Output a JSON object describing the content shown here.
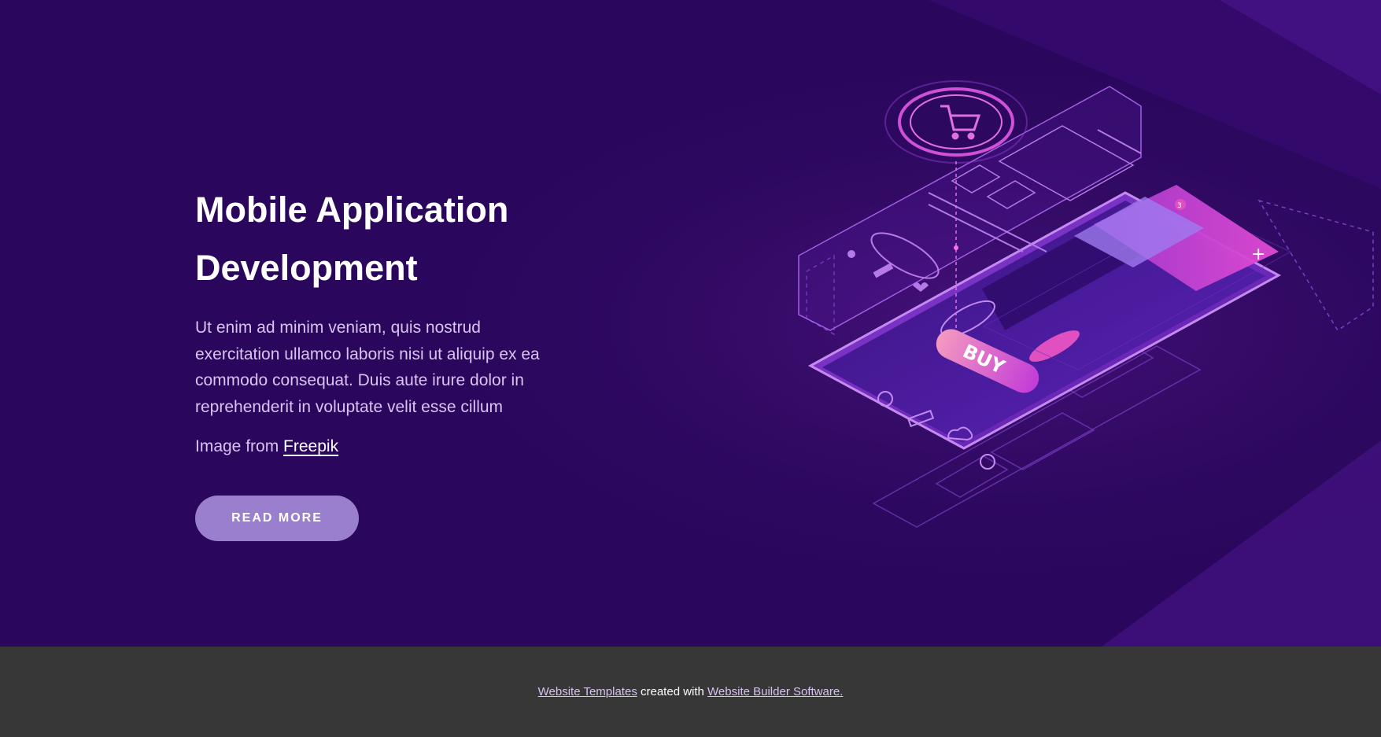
{
  "hero": {
    "title_line1": "Mobile Application",
    "title_line2": "Development",
    "text": "Ut enim ad minim veniam, quis nostrud exercitation ullamco laboris nisi ut aliquip ex ea commodo consequat. Duis aute irure dolor in reprehenderit in voluptate velit esse cillum",
    "credit_prefix": "Image from",
    "credit_link": "Freepik",
    "button_label": "READ MORE"
  },
  "illustration": {
    "buy_label": "BUY",
    "cart_badge": "3"
  },
  "footer": {
    "link1": "Website Templates",
    "middle": "created with",
    "link2": "Website Builder Software."
  },
  "colors": {
    "background": "#2a075c",
    "button": "#9a7fcf",
    "footer": "#373737",
    "accent_pink": "#e040c8"
  }
}
